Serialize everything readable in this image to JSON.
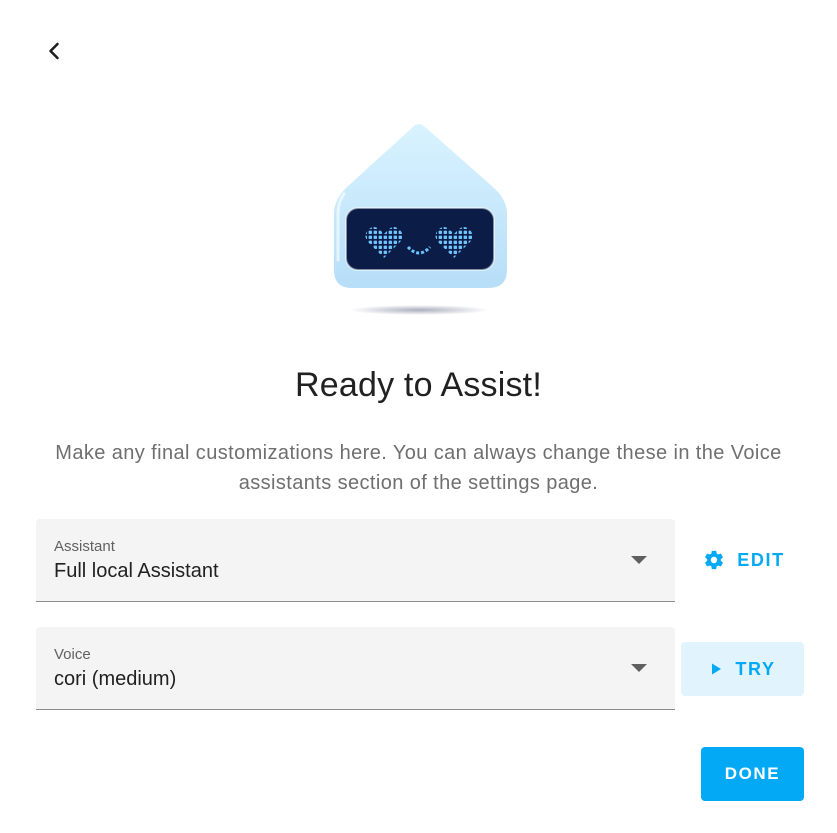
{
  "dialog": {
    "title": "Ready to Assist!",
    "description": "Make any final customizations here. You can always change these in the Voice assistants section of the settings page."
  },
  "fields": {
    "assistant": {
      "label": "Assistant",
      "value": "Full local Assistant"
    },
    "voice": {
      "label": "Voice",
      "value": "cori (medium)"
    }
  },
  "buttons": {
    "edit": "EDIT",
    "try": "TRY",
    "done": "DONE"
  },
  "icons": {
    "back": "chevron-left-icon",
    "edit": "gear-icon",
    "try": "play-icon",
    "dropdown": "triangle-down-icon"
  },
  "colors": {
    "accent": "#03a9f4",
    "accent_light": "#e1f3fc",
    "field_bg": "#f4f4f4",
    "mascot_body": "#cdeefe",
    "mascot_screen": "#0b1c46",
    "mascot_pixels": "#6ec3ff"
  }
}
